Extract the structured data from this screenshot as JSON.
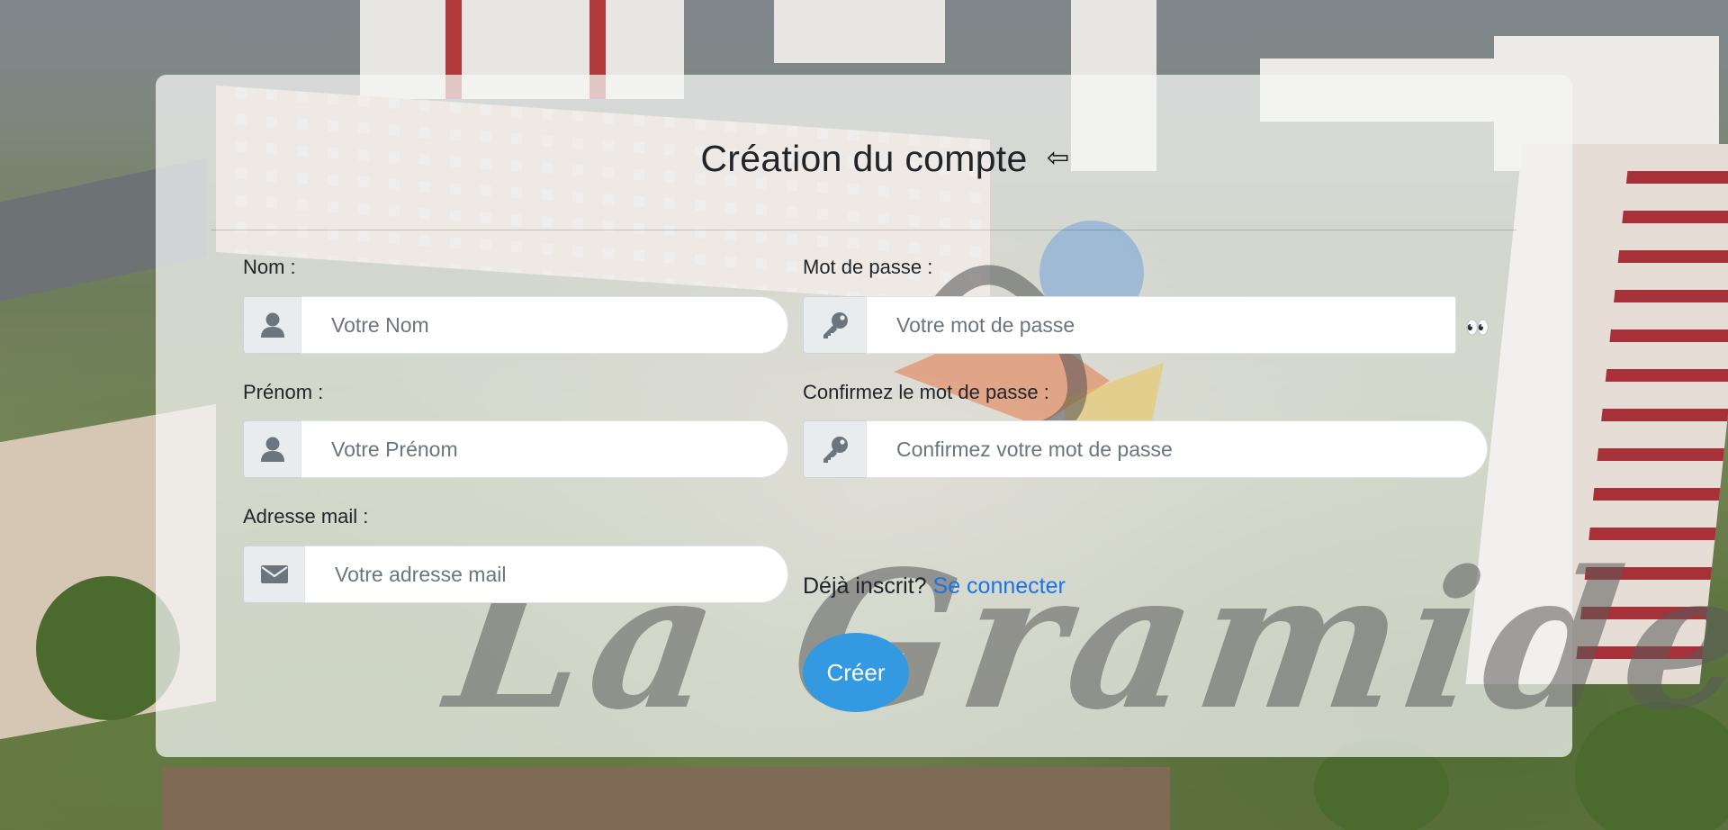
{
  "form": {
    "title": "Création du compte",
    "back_icon": "⇦",
    "nom": {
      "label": "Nom :",
      "placeholder": "Votre Nom",
      "icon": "user-icon"
    },
    "prenom": {
      "label": "Prénom :",
      "placeholder": "Votre Prénom",
      "icon": "user-icon"
    },
    "email": {
      "label": "Adresse mail :",
      "placeholder": "Votre adresse mail",
      "icon": "envelope-icon"
    },
    "password": {
      "label": "Mot de passe :",
      "placeholder": "Votre mot de passe",
      "icon": "key-icon"
    },
    "password_confirm": {
      "label": "Confirmez le mot de passe :",
      "placeholder": "Confirmez votre mot de passe",
      "icon": "key-icon"
    },
    "toggle_icon": "👀",
    "already_text": "Déjà inscrit?",
    "login_link": "Se connecter",
    "submit_label": "Créer"
  },
  "colors": {
    "accent": "#3399e0",
    "link": "#1a73e8",
    "panel": "rgba(245,245,245,0.74)"
  }
}
